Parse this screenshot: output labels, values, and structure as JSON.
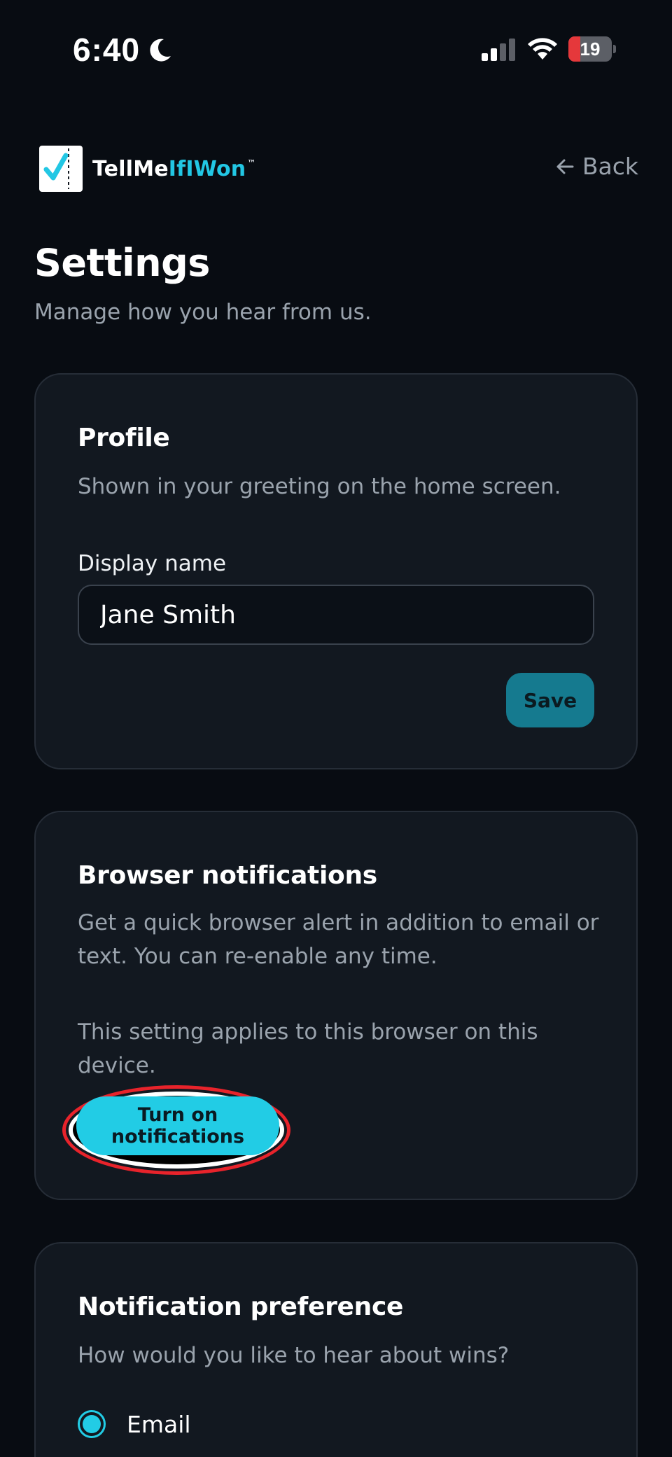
{
  "status_bar": {
    "time": "6:40",
    "battery_level": "19",
    "battery_fraction": 0.19
  },
  "header": {
    "logo_part_1": "TellMe",
    "logo_part_2": "IfIWon",
    "logo_tm": "™",
    "back_label": "Back"
  },
  "page": {
    "title": "Settings",
    "subtitle": "Manage how you hear from us."
  },
  "profile": {
    "title": "Profile",
    "description": "Shown in your greeting on the home screen.",
    "field_label": "Display name",
    "display_name_value": "Jane Smith",
    "save_label": "Save"
  },
  "browser_notifications": {
    "title": "Browser notifications",
    "description": "Get a quick browser alert in addition to email or text. You can re-enable any time.",
    "note": "This setting applies to this browser on this device.",
    "button_label": "Turn on notifications"
  },
  "notification_preference": {
    "title": "Notification preference",
    "question": "How would you like to hear about wins?",
    "options": [
      {
        "label": "Email",
        "selected": true
      }
    ]
  },
  "colors": {
    "background": "#080c12",
    "card": "#121820",
    "accent": "#22cce5",
    "save_button": "#157a8f",
    "highlight_ring": "#e8232b"
  }
}
